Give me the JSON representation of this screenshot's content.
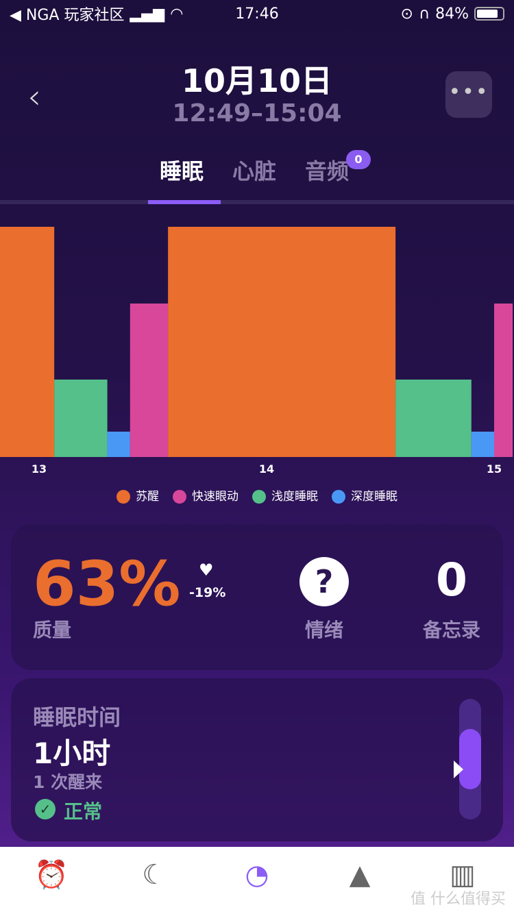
{
  "status_bar": {
    "back_app": "◀ NGA 玩家社区",
    "time": "17:46",
    "battery": "84%",
    "battery_level": 0.84
  },
  "header": {
    "back": "‹",
    "title": "10月10日",
    "time_range": "12:49–15:04",
    "more": "•••"
  },
  "tabs": [
    {
      "label": "睡眠",
      "active": true
    },
    {
      "label": "心脏",
      "active": false
    },
    {
      "label": "音频",
      "active": false,
      "badge": "0"
    }
  ],
  "chart_data": {
    "type": "bar",
    "x_ticks": [
      "13",
      "14",
      "15"
    ],
    "xlim": [
      "12:49",
      "15:05"
    ],
    "levels": [
      "深度睡眠",
      "浅度睡眠",
      "快速眼动",
      "苏醒"
    ],
    "segments": [
      {
        "stage": "苏醒",
        "start": "12:49",
        "end": "13:04"
      },
      {
        "stage": "浅度睡眠",
        "start": "13:04",
        "end": "13:18"
      },
      {
        "stage": "深度睡眠",
        "start": "13:18",
        "end": "13:24"
      },
      {
        "stage": "快速眼动",
        "start": "13:24",
        "end": "13:34"
      },
      {
        "stage": "苏醒",
        "start": "13:34",
        "end": "14:34"
      },
      {
        "stage": "浅度睡眠",
        "start": "14:34",
        "end": "14:54"
      },
      {
        "stage": "深度睡眠",
        "start": "14:54",
        "end": "15:00"
      },
      {
        "stage": "快速眼动",
        "start": "15:00",
        "end": "15:05"
      }
    ],
    "legend": [
      {
        "label": "苏醒",
        "color": "#ea6e2e"
      },
      {
        "label": "快速眼动",
        "color": "#d8479a"
      },
      {
        "label": "浅度睡眠",
        "color": "#55c08a"
      },
      {
        "label": "深度睡眠",
        "color": "#4a98f5"
      }
    ],
    "legend_position": "bottom"
  },
  "summary": {
    "quality_value": "63%",
    "quality_label": "质量",
    "delta": "-19%",
    "mood_icon": "?",
    "mood_label": "情绪",
    "memo_value": "0",
    "memo_label": "备忘录"
  },
  "sleep": {
    "label": "睡眠时间",
    "duration": "1小时",
    "wakeups": "1 次醒来",
    "status": "正常",
    "status_color": "#55c08a"
  },
  "nav": [
    "alarm-icon",
    "sleep-music-icon",
    "sleep-tracker-icon",
    "mountain-icon",
    "stats-icon"
  ],
  "watermark": "值 什么值得买"
}
